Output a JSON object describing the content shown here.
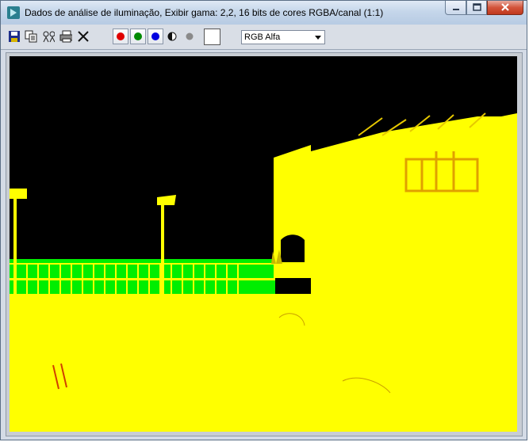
{
  "window": {
    "title": "Dados de análise de iluminação, Exibir gama: 2,2, 16 bits de cores RGBA/canal (1:1)",
    "app_icon": "3ds-max-icon",
    "controls": [
      "minimize-icon",
      "maximize-icon",
      "close-icon"
    ]
  },
  "toolbar": {
    "buttons": [
      "save-icon",
      "copy-icon",
      "clone-icon",
      "print-icon",
      "clear-icon"
    ],
    "channels": [
      {
        "name": "red",
        "color": "#e00000"
      },
      {
        "name": "green",
        "color": "#008a00"
      },
      {
        "name": "blue",
        "color": "#0000e0"
      }
    ],
    "monochrome_icon": "half-circle-icon",
    "gray_dot_color": "#8a8a8a",
    "swatch_color": "#ffffff",
    "channel_select": {
      "value": "RGB Alfa"
    }
  },
  "render": {
    "background": "#000000",
    "lit_color": "#ffff00",
    "fence_color": "#00ff00"
  }
}
